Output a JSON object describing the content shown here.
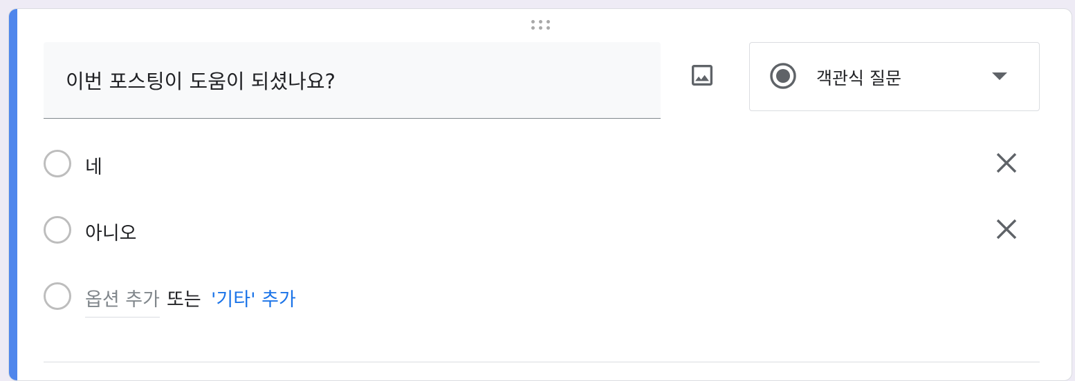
{
  "question": {
    "title": "이번 포스팅이 도움이 되셨나요?"
  },
  "type_selector": {
    "label": "객관식 질문",
    "icon": "radio-button-checked-icon"
  },
  "options": [
    {
      "label": "네"
    },
    {
      "label": "아니오"
    }
  ],
  "add_option": {
    "placeholder": "옵션 추가",
    "or_text": "또는",
    "add_other_label": "'기타' 추가"
  },
  "colors": {
    "accent": "#4f86ec",
    "link": "#1a73e8",
    "icon": "#5f6368"
  }
}
